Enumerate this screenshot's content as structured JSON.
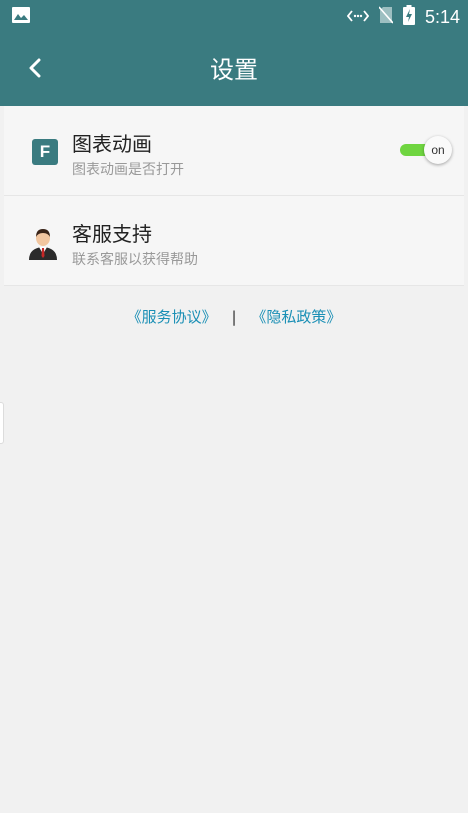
{
  "status_bar": {
    "time": "5:14",
    "icons": [
      "image-icon",
      "data-transfer-icon",
      "no-sim-icon",
      "battery-charging-icon"
    ]
  },
  "header": {
    "title": "设置"
  },
  "settings": {
    "items": [
      {
        "icon": "f-app-icon",
        "icon_letter": "F",
        "title": "图表动画",
        "subtitle": "图表动画是否打开",
        "toggle_label": "on",
        "toggle_on": true
      },
      {
        "icon": "customer-service-avatar-icon",
        "title": "客服支持",
        "subtitle": "联系客服以获得帮助"
      }
    ]
  },
  "footer_links": {
    "service_agreement": "《服务协议》",
    "separator": "|",
    "privacy_policy": "《隐私政策》"
  },
  "colors": {
    "primary": "#3a7b80",
    "toggle_on": "#6fd540",
    "link": "#1a8fb5",
    "background": "#f1f1f1"
  }
}
